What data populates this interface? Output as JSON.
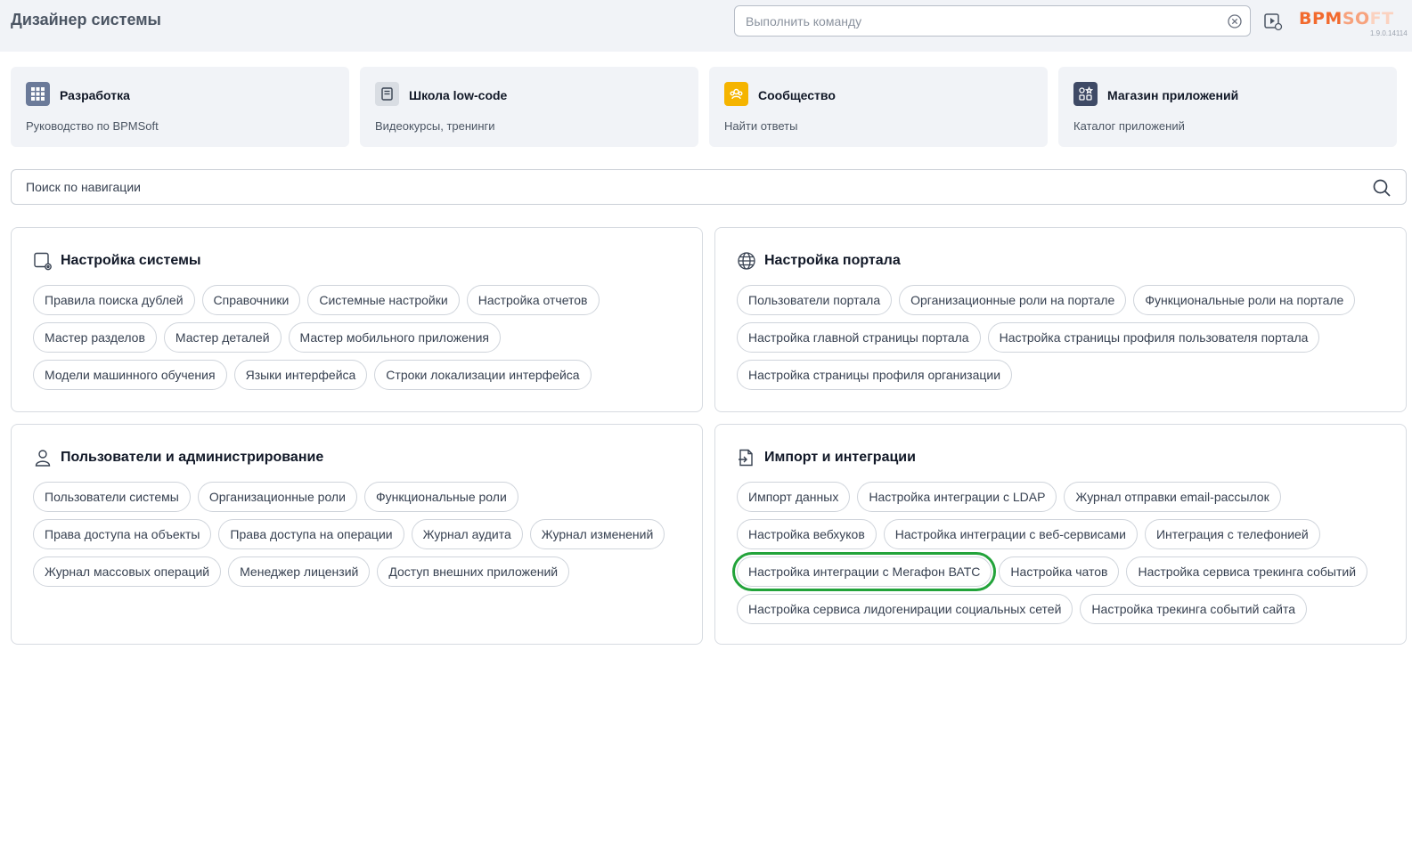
{
  "header": {
    "title": "Дизайнер системы",
    "command_placeholder": "Выполнить команду",
    "logo_parts": [
      "BPM",
      "SO",
      "FT"
    ],
    "version": "1.9.0.14114"
  },
  "cards": [
    {
      "title": "Разработка",
      "subtitle": "Руководство по BPMSoft",
      "icon": "grid-icon",
      "color": "#6b7a99"
    },
    {
      "title": "Школа low-code",
      "subtitle": "Видеокурсы, тренинги",
      "icon": "book-icon",
      "color": "#d9dde3"
    },
    {
      "title": "Сообщество",
      "subtitle": "Найти ответы",
      "icon": "community-icon",
      "color": "#f5b400"
    },
    {
      "title": "Магазин приложений",
      "subtitle": "Каталог приложений",
      "icon": "apps-icon",
      "color": "#3f4a66"
    }
  ],
  "nav_search": {
    "placeholder": "Поиск по навигации"
  },
  "sections": {
    "system": {
      "title": "Настройка системы",
      "items": [
        "Правила поиска дублей",
        "Справочники",
        "Системные настройки",
        "Настройка отчетов",
        "Мастер разделов",
        "Мастер деталей",
        "Мастер мобильного приложения",
        "Модели машинного обучения",
        "Языки интерфейса",
        "Строки локализации интерфейса"
      ]
    },
    "portal": {
      "title": "Настройка портала",
      "items": [
        "Пользователи портала",
        "Организационные роли на портале",
        "Функциональные роли на портале",
        "Настройка главной страницы портала",
        "Настройка страницы профиля пользователя портала",
        "Настройка страницы профиля организации"
      ]
    },
    "users": {
      "title": "Пользователи и администрирование",
      "items": [
        "Пользователи системы",
        "Организационные роли",
        "Функциональные роли",
        "Права доступа на объекты",
        "Права доступа на операции",
        "Журнал аудита",
        "Журнал изменений",
        "Журнал массовых операций",
        "Менеджер лицензий",
        "Доступ внешних приложений"
      ]
    },
    "import": {
      "title": "Импорт и интеграции",
      "items": [
        "Импорт данных",
        "Настройка интеграции с LDAP",
        "Журнал отправки email-рассылок",
        "Настройка вебхуков",
        "Настройка интеграции с веб-сервисами",
        "Интеграция с телефонией",
        "Настройка интеграции с Мегафон ВАТС",
        "Настройка чатов",
        "Настройка сервиса трекинга событий",
        "Настройка сервиса лидогенирации социальных сетей",
        "Настройка трекинга событий сайта"
      ],
      "highlighted_item": "Настройка интеграции с Мегафон ВАТС",
      "highlight_color": "#22a33a"
    }
  }
}
